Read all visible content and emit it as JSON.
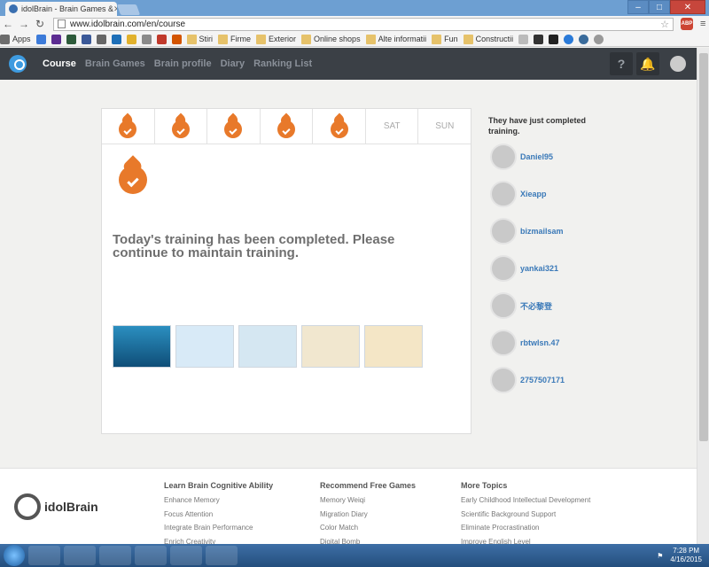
{
  "browser": {
    "tab_title": "idolBrain - Brain Games &",
    "url": "www.idolbrain.com/en/course",
    "bookmarks": [
      "Apps",
      "Stiri",
      "Firme",
      "Exterior",
      "Online shops",
      "Alte informatii",
      "Fun",
      "Constructii"
    ]
  },
  "header": {
    "nav": [
      "Course",
      "Brain Games",
      "Brain profile",
      "Diary",
      "Ranking List"
    ],
    "help": "?"
  },
  "week": {
    "days": [
      {
        "done": true,
        "label": ""
      },
      {
        "done": true,
        "label": ""
      },
      {
        "done": true,
        "label": ""
      },
      {
        "done": true,
        "label": ""
      },
      {
        "done": true,
        "label": ""
      },
      {
        "done": false,
        "label": "SAT"
      },
      {
        "done": false,
        "label": "SUN"
      }
    ]
  },
  "main": {
    "message": "Today's training has been completed. Please continue to maintain training."
  },
  "sidebar": {
    "title": "They have just completed training.",
    "users": [
      "Daniel95",
      "Xieapp",
      "bizmailsam",
      "yankai321",
      "不必黎登",
      "rbtwlsn.47",
      "2757507171"
    ]
  },
  "footer": {
    "logo": "idolBrain",
    "col1": {
      "title": "Learn Brain Cognitive Ability",
      "items": [
        "Enhance Memory",
        "Focus Attention",
        "Integrate Brain Performance",
        "Enrich Creativity"
      ]
    },
    "col2": {
      "title": "Recommend Free Games",
      "items": [
        "Memory Weiqi",
        "Migration Diary",
        "Color Match",
        "Digital Bomb"
      ]
    },
    "col3": {
      "title": "More Topics",
      "items": [
        "Early Childhood Intellectual Development",
        "Scientific Background Support",
        "Eliminate Procrastination",
        "Improve English Level"
      ]
    }
  },
  "taskbar": {
    "time": "7:28 PM",
    "date": "4/16/2015"
  }
}
